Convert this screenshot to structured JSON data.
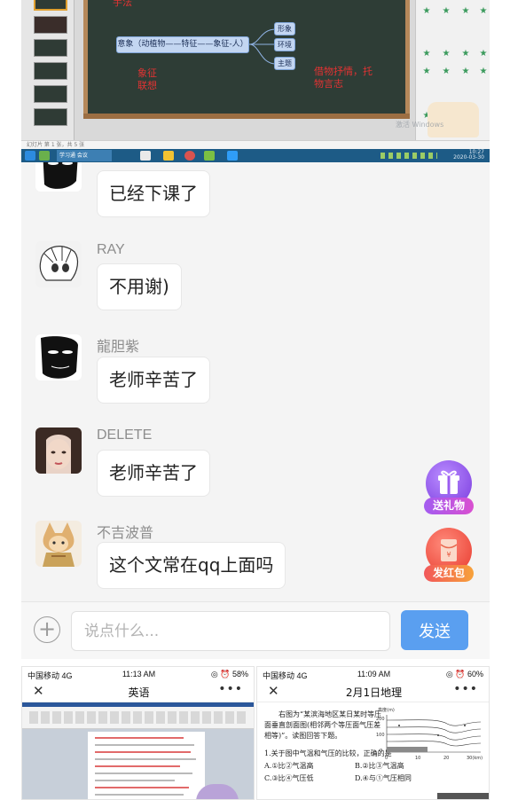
{
  "pc_screenshot": {
    "slide_red_notes": [
      "手法",
      "象征\n联想",
      "借物抒情，托\n物言志"
    ],
    "mind_map": {
      "center": "意象（动植物——特征——象征-人）",
      "branches": [
        "形象",
        "环境",
        "主题"
      ]
    },
    "watermark": "激活 Windows",
    "status_text": "幻灯片 第 1 张，共 5 张",
    "clock": [
      "10:27",
      "2020-03-30"
    ],
    "taskbar_task": "学习通 会议"
  },
  "chat": {
    "messages": [
      {
        "sender": "",
        "text": "已经下课了",
        "avatar": "mask-avatar"
      },
      {
        "sender": "RAY",
        "text": "不用谢)",
        "avatar": "sketch-avatar"
      },
      {
        "sender": "龍胆紫",
        "text": "老师辛苦了",
        "avatar": "mask-avatar"
      },
      {
        "sender": "DELETE",
        "text": "老师辛苦了",
        "avatar": "photo-avatar"
      },
      {
        "sender": "不吉波普",
        "text": "这个文常在qq上面吗",
        "avatar": "anime-avatar"
      }
    ],
    "gift_label": "送礼物",
    "redpacket_label": "发红包",
    "input_placeholder": "说点什么...",
    "send_label": "发送",
    "colors": {
      "send": "#5a9ff0",
      "gift": "#9b5cf0",
      "redpacket": "#f04b4b"
    }
  },
  "phones": [
    {
      "carrier": "中国移动  4G",
      "time": "11:13 AM",
      "battery": "◎ ⏰ 58%",
      "title": "英语",
      "close_icon": "close-icon",
      "more_icon": "more-icon"
    },
    {
      "carrier": "中国移动  4G",
      "time": "11:09 AM",
      "battery": "◎ ⏰ 60%",
      "title": "2月1日地理",
      "close_icon": "close-icon",
      "more_icon": "more-icon",
      "question_intro": "右图为“某滨海地区某日某时等压面垂直剖面图(相邻两个等压面气压差相等)”。读图回答下题。",
      "question": "1.关于图中气温和气压的比较，正确的是",
      "options": [
        "A.①比②气温高",
        "B.②比③气温高",
        "C.③比④气压低",
        "D.④与①气压相同"
      ],
      "chart_axis": {
        "y_label": "高度(m)",
        "y_ticks": [
          "200",
          "100",
          "0"
        ],
        "x_ticks": [
          "0",
          "10",
          "20",
          "30(km)"
        ]
      }
    }
  ]
}
